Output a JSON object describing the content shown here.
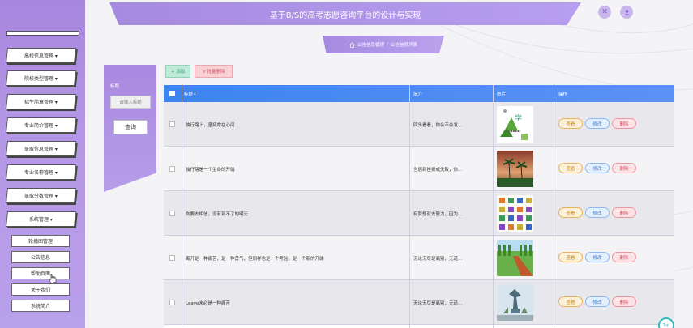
{
  "header": {
    "title": "基于B/S的高考志愿咨询平台的设计与实现",
    "close_icon": "close-icon",
    "user_icon": "user-icon"
  },
  "breadcrumb": {
    "home": "公告信息管理",
    "separator": "/",
    "current": "公告信息列表"
  },
  "sidebar": {
    "menu": [
      {
        "label": "高校信息管理 ▾"
      },
      {
        "label": "院校类型管理 ▾"
      },
      {
        "label": "招生简章管理 ▾"
      },
      {
        "label": "专业简介管理 ▾"
      },
      {
        "label": "录取信息管理 ▾"
      },
      {
        "label": "专业名称管理 ▾"
      },
      {
        "label": "录取分数管理 ▾"
      },
      {
        "label": "系统管理 ▾"
      }
    ],
    "submenu": [
      {
        "label": "轮播图管理"
      },
      {
        "label": "公告信息"
      },
      {
        "label": "帮助页面"
      },
      {
        "label": "关于我们"
      },
      {
        "label": "系统简介"
      }
    ]
  },
  "search": {
    "label": "标题",
    "placeholder": "请输入标题",
    "button": "查询"
  },
  "toolbar": {
    "add": "+ 添加",
    "batch_delete": "× 批量删除"
  },
  "table": {
    "headers": {
      "title": "标题",
      "summary": "简介",
      "image": "图片",
      "actions": "操作"
    },
    "rows": [
      {
        "title": "独行路上，坚持常在心间",
        "summary": "回头看看，你会不会发...",
        "image": "logo-thumbnail"
      },
      {
        "title": "独行路是一个生命的开端",
        "summary": "当遇到挫折或失败，你...",
        "image": "palm-sunset-thumbnail"
      },
      {
        "title": "你要去相信，没有到不了的明天",
        "summary": "有梦想就去努力，因为...",
        "image": "icon-grid-thumbnail"
      },
      {
        "title": "离开是一种痛苦，是一种勇气，但同样也是一个考验，是一个新的开端",
        "summary": "无论无尽是离别，无道...",
        "image": "road-field-thumbnail"
      },
      {
        "title": "Leave未必是一种痛苦",
        "summary": "无论无尽是离别，无道...",
        "image": "sculpture-thumbnail"
      }
    ],
    "actions": {
      "view": "查看",
      "edit": "修改",
      "delete": "删除"
    }
  },
  "top_button": "Top"
}
